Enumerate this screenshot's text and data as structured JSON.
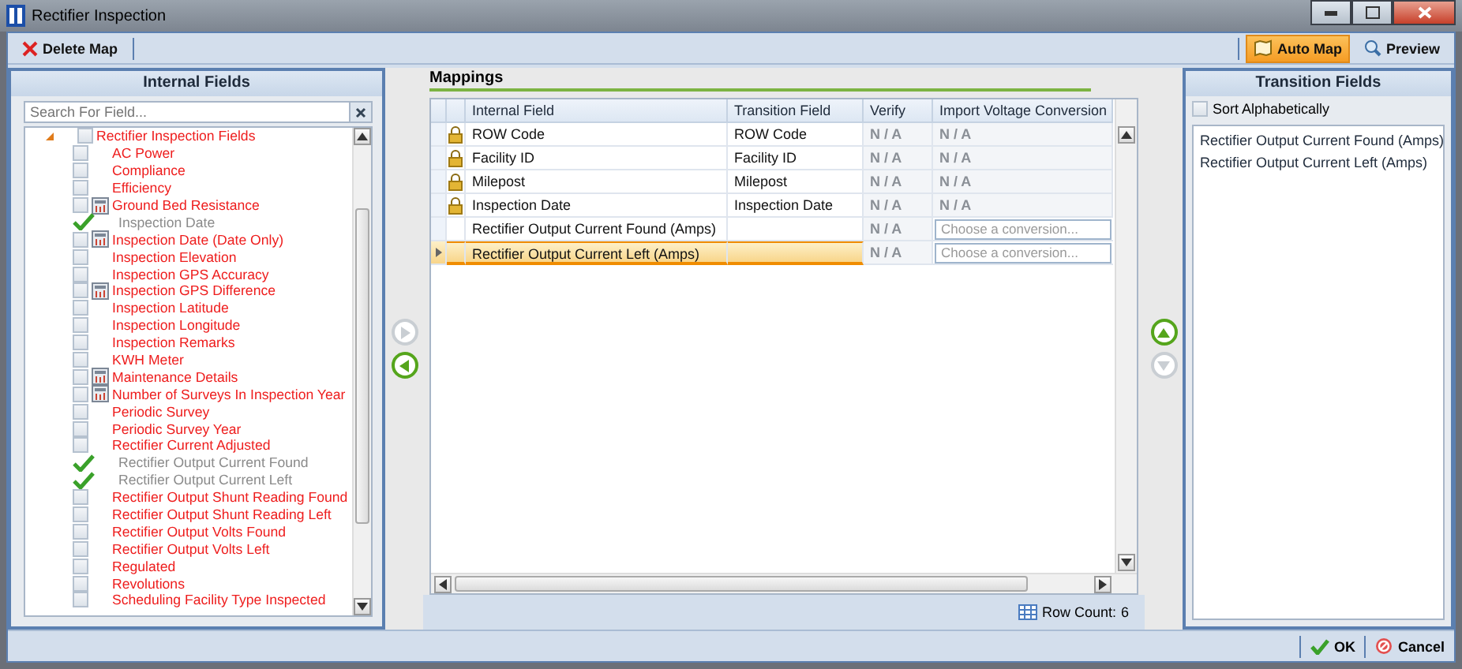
{
  "window": {
    "title": "Rectifier Inspection"
  },
  "toolbar": {
    "left": [
      {
        "label": "Delete Map",
        "kind": "delete"
      }
    ],
    "right": [
      {
        "label": "Auto Map",
        "kind": "auto",
        "selected": true
      },
      {
        "label": "Preview",
        "kind": "preview",
        "selected": false
      }
    ]
  },
  "internal_fields": {
    "title": "Internal Fields",
    "search": {
      "placeholder": "Search For Field..."
    },
    "tree": [
      {
        "label": "Rectifier Inspection Fields",
        "expanded": true,
        "checked": false,
        "children": [
          {
            "label": "AC Power",
            "mapped": false,
            "calculated": false
          },
          {
            "label": "Compliance",
            "mapped": false,
            "calculated": false
          },
          {
            "label": "Efficiency",
            "mapped": false,
            "calculated": false
          },
          {
            "label": "Ground Bed Resistance",
            "mapped": false,
            "calculated": true
          },
          {
            "label": "Inspection Date",
            "mapped": true,
            "calculated": false
          },
          {
            "label": "Inspection Date (Date Only)",
            "mapped": false,
            "calculated": true
          },
          {
            "label": "Inspection Elevation",
            "mapped": false,
            "calculated": false
          },
          {
            "label": "Inspection GPS Accuracy",
            "mapped": false,
            "calculated": false
          },
          {
            "label": "Inspection GPS Difference",
            "mapped": false,
            "calculated": true
          },
          {
            "label": "Inspection Latitude",
            "mapped": false,
            "calculated": false
          },
          {
            "label": "Inspection Longitude",
            "mapped": false,
            "calculated": false
          },
          {
            "label": "Inspection Remarks",
            "mapped": false,
            "calculated": false
          },
          {
            "label": "KWH Meter",
            "mapped": false,
            "calculated": false
          },
          {
            "label": "Maintenance Details",
            "mapped": false,
            "calculated": true
          },
          {
            "label": "Number of Surveys In Inspection Year",
            "mapped": false,
            "calculated": true
          },
          {
            "label": "Periodic Survey",
            "mapped": false,
            "calculated": false
          },
          {
            "label": "Periodic Survey Year",
            "mapped": false,
            "calculated": false
          },
          {
            "label": "Rectifier Current Adjusted",
            "mapped": false,
            "calculated": false
          },
          {
            "label": "Rectifier Output Current Found",
            "mapped": true,
            "calculated": false
          },
          {
            "label": "Rectifier Output Current Left",
            "mapped": true,
            "calculated": false
          },
          {
            "label": "Rectifier Output Shunt Reading Found",
            "mapped": false,
            "calculated": false
          },
          {
            "label": "Rectifier Output Shunt Reading Left",
            "mapped": false,
            "calculated": false
          },
          {
            "label": "Rectifier Output Volts Found",
            "mapped": false,
            "calculated": false
          },
          {
            "label": "Rectifier Output Volts Left",
            "mapped": false,
            "calculated": false
          },
          {
            "label": "Regulated",
            "mapped": false,
            "calculated": false
          },
          {
            "label": "Revolutions",
            "mapped": false,
            "calculated": false
          },
          {
            "label": "Scheduling Facility Type Inspected",
            "mapped": false,
            "calculated": false
          }
        ]
      }
    ]
  },
  "mappings": {
    "title": "Mappings",
    "columns": [
      "Internal Field",
      "Transition Field",
      "Verify",
      "Import Voltage Conversion"
    ],
    "rows": [
      {
        "locked": true,
        "selected": false,
        "internal": "ROW Code",
        "transition": "ROW Code",
        "verify": "N / A",
        "conversion": {
          "kind": "text",
          "text": "N / A"
        }
      },
      {
        "locked": true,
        "selected": false,
        "internal": "Facility ID",
        "transition": "Facility ID",
        "verify": "N / A",
        "conversion": {
          "kind": "text",
          "text": "N / A"
        }
      },
      {
        "locked": true,
        "selected": false,
        "internal": "Milepost",
        "transition": "Milepost",
        "verify": "N / A",
        "conversion": {
          "kind": "text",
          "text": "N / A"
        }
      },
      {
        "locked": true,
        "selected": false,
        "internal": "Inspection Date",
        "transition": "Inspection Date",
        "verify": "N / A",
        "conversion": {
          "kind": "text",
          "text": "N / A"
        }
      },
      {
        "locked": false,
        "selected": false,
        "internal": "Rectifier Output Current Found (Amps)",
        "verify": "N / A",
        "conversion": {
          "kind": "dropdown",
          "placeholder": "Choose a conversion..."
        }
      },
      {
        "locked": false,
        "selected": true,
        "internal": "Rectifier Output Current Left (Amps)",
        "verify": "N / A",
        "conversion": {
          "kind": "dropdown",
          "placeholder": "Choose a conversion..."
        }
      }
    ],
    "row_count_label": "Row Count:",
    "row_count": "6"
  },
  "transition_fields": {
    "title": "Transition Fields",
    "sort_alphabetically": {
      "label": "Sort Alphabetically",
      "checked": false
    },
    "items": [
      "Rectifier Output Current Found (Amps)",
      "Rectifier Output Current Left (Amps)"
    ]
  },
  "buttons": [
    {
      "label": "OK",
      "kind": "ok"
    },
    {
      "label": "Cancel",
      "kind": "cancel"
    }
  ]
}
